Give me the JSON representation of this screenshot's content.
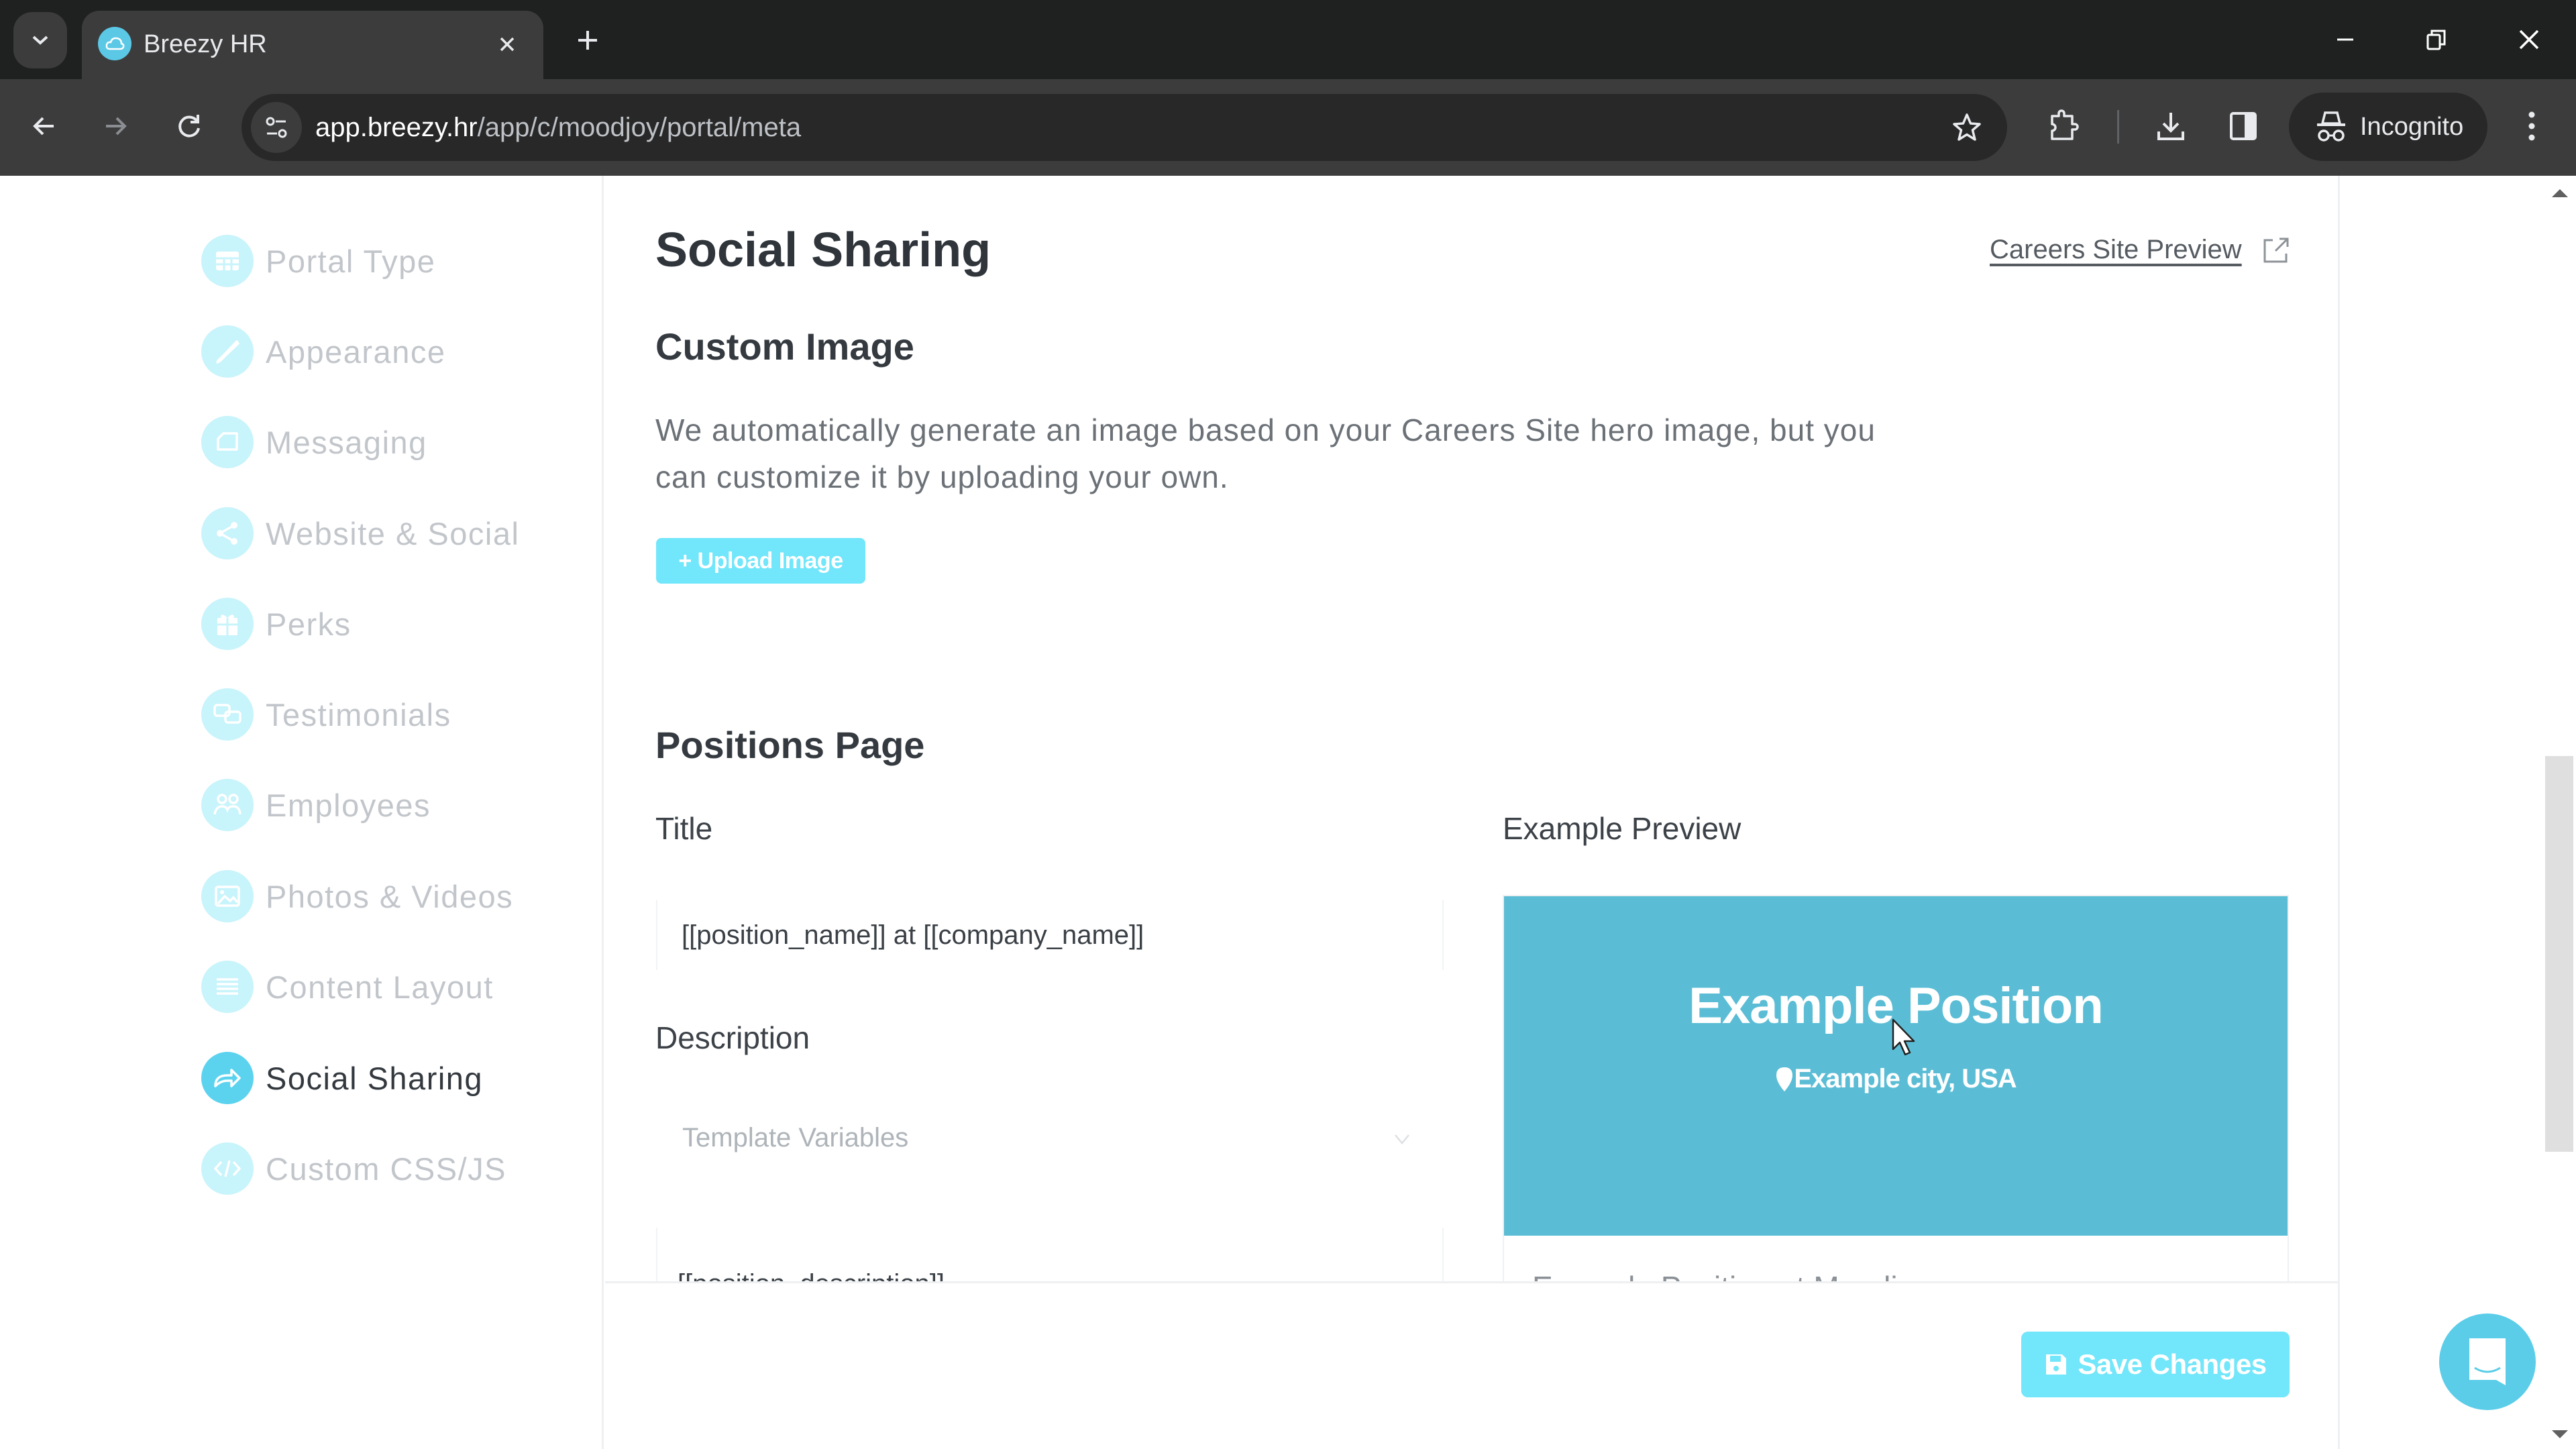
{
  "browser": {
    "tab_title": "Breezy HR",
    "url_host": "app.breezy.hr",
    "url_path": "/app/c/moodjoy/portal/meta",
    "profile_label": "Incognito"
  },
  "sidebar": {
    "items": [
      {
        "label": "Portal Type",
        "icon": "grid-icon",
        "active": false
      },
      {
        "label": "Appearance",
        "icon": "brush-icon",
        "active": false
      },
      {
        "label": "Messaging",
        "icon": "message-icon",
        "active": false
      },
      {
        "label": "Website & Social",
        "icon": "share-icon",
        "active": false
      },
      {
        "label": "Perks",
        "icon": "gift-icon",
        "active": false
      },
      {
        "label": "Testimonials",
        "icon": "chat-bubbles-icon",
        "active": false
      },
      {
        "label": "Employees",
        "icon": "people-icon",
        "active": false
      },
      {
        "label": "Photos & Videos",
        "icon": "image-icon",
        "active": false
      },
      {
        "label": "Content Layout",
        "icon": "list-icon",
        "active": false
      },
      {
        "label": "Social Sharing",
        "icon": "share-arrow-icon",
        "active": true
      },
      {
        "label": "Custom CSS/JS",
        "icon": "code-icon",
        "active": false
      }
    ]
  },
  "main": {
    "title": "Social Sharing",
    "preview_link": "Careers Site Preview",
    "custom_image": {
      "heading": "Custom Image",
      "description": "We automatically generate an image based on your Careers Site hero image, but you can customize it by uploading your own.",
      "upload_button": "+ Upload Image"
    },
    "positions_page": {
      "heading": "Positions Page",
      "title_label": "Title",
      "title_value": "[[position_name]] at [[company_name]]",
      "description_label": "Description",
      "template_variables_placeholder": "Template Variables",
      "description_value": "[[position_description]]",
      "example_preview_label": "Example Preview",
      "preview": {
        "position": "Example Position",
        "location": "Example city, USA",
        "subtitle": "Example Position at Moodjoy"
      }
    },
    "save_button": "Save Changes"
  },
  "colors": {
    "accent": "#5bd3ef",
    "button": "#72e6fa",
    "preview_hero": "#5bbdd5"
  }
}
